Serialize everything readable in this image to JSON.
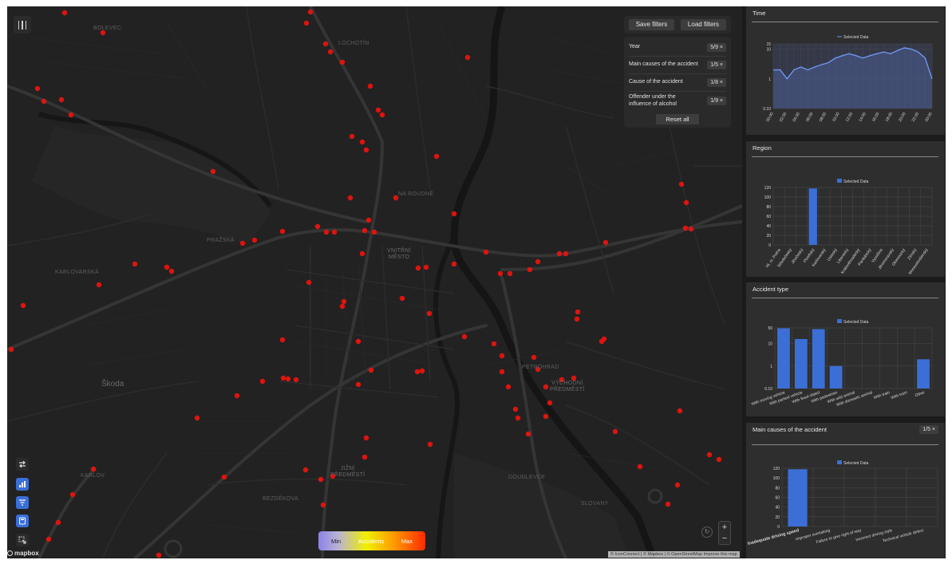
{
  "map": {
    "labels": [
      {
        "text": "Škoda",
        "style": "big",
        "x": 118,
        "y": 468
      },
      {
        "text": "VNITŘNÍ\nMĚSTO",
        "style": "district",
        "x": 476,
        "y": 303
      },
      {
        "text": "VÝCHODNÍ\nPŘEDMĚSTÍ",
        "style": "district",
        "x": 680,
        "y": 469
      },
      {
        "text": "JIŽNÍ\nPŘEDMĚSTÍ",
        "style": "district",
        "x": 405,
        "y": 576
      },
      {
        "text": "PETROHRAD",
        "style": "small",
        "x": 645,
        "y": 449
      },
      {
        "text": "KARLOV",
        "style": "small",
        "x": 92,
        "y": 585
      },
      {
        "text": "BEZDĚKOVA",
        "style": "small",
        "x": 320,
        "y": 614
      },
      {
        "text": "DOUDLEVCE",
        "style": "small",
        "x": 628,
        "y": 587
      },
      {
        "text": "SLOVANY",
        "style": "small",
        "x": 719,
        "y": 620
      },
      {
        "text": "BOLEVEC",
        "style": "small",
        "x": 108,
        "y": 24
      },
      {
        "text": "NA ROUDNÉ",
        "style": "small",
        "x": 490,
        "y": 232
      },
      {
        "text": "KARLOVARSKÁ",
        "style": "small",
        "x": 60,
        "y": 330
      },
      {
        "text": "LOCHOTÍN",
        "style": "small",
        "x": 415,
        "y": 43
      },
      {
        "text": "PRAŽSKÁ",
        "style": "small",
        "x": 250,
        "y": 290
      }
    ],
    "hotspot_color": "#e8140e",
    "toolbar_icons": [
      "route-icon",
      "bar-chart-icon",
      "filter-icon",
      "calculator-icon",
      "select-area-icon"
    ]
  },
  "filters": {
    "save_label": "Save filters",
    "load_label": "Load filters",
    "rows": [
      {
        "label": "Year",
        "badge": "5/9 ×"
      },
      {
        "label": "Main causes of the accident",
        "badge": "1/5 ×"
      },
      {
        "label": "Cause of the accident",
        "badge": "1/8 ×"
      },
      {
        "label": "Offender under the influence of alcohol",
        "badge": "1/9 ×"
      }
    ],
    "reset_label": "Reset all"
  },
  "legend": {
    "min": "Min",
    "mid": "Accidents",
    "max": "Max"
  },
  "zoom": {
    "plus": "+",
    "minus": "−"
  },
  "mapbox": {
    "logo": "mapbox",
    "attribution": "© IconConnect | © Mapbox | © OpenStreetMap Improve this map"
  },
  "panels": {
    "time": {
      "title": "Time"
    },
    "region": {
      "title": "Region"
    },
    "accident_type": {
      "title": "Accident type"
    },
    "main_causes": {
      "title": "Main causes of the accident",
      "badge": "1/5 ×"
    }
  },
  "chart_data": [
    {
      "type": "line",
      "panel": "Time",
      "legend": "Selected Data",
      "y_scale": "log",
      "ylim": [
        0.1,
        15
      ],
      "y_ticks": [
        "15",
        "10",
        "1",
        "0.10"
      ],
      "x": [
        "00:00",
        "01:00",
        "02:00",
        "03:00",
        "04:00",
        "05:00",
        "06:00",
        "07:00",
        "08:00",
        "09:00",
        "10:00",
        "11:00",
        "12:00",
        "13:00",
        "14:00",
        "15:00",
        "16:00",
        "17:00",
        "18:00",
        "19:00",
        "20:00",
        "21:00",
        "22:00",
        "23:00"
      ],
      "x_tick_labels": [
        "00:00",
        "02:00",
        "04:00",
        "06:00",
        "08:00",
        "10:00",
        "12:00",
        "14:00",
        "16:00",
        "18:00",
        "20:00",
        "22:00",
        "00:00"
      ],
      "values": [
        2,
        2,
        1,
        2,
        2.5,
        2,
        2.5,
        3,
        3.5,
        5,
        6,
        7,
        6,
        5,
        6,
        7,
        8,
        7,
        9,
        11,
        10,
        8,
        5,
        1
      ]
    },
    {
      "type": "bar",
      "panel": "Region",
      "legend": "Selected Data",
      "ylim": [
        0,
        120
      ],
      "y_ticks": [
        0,
        20,
        40,
        60,
        80,
        100,
        120
      ],
      "categories": [
        "Hl. m. Praha",
        "Středočeský",
        "Jihočeský",
        "Plzeňský",
        "Karlovarský",
        "Ústecký",
        "Liberecký",
        "Královéhradecký",
        "Pardubický",
        "Vysočina",
        "Jihomoravský",
        "Olomoucký",
        "Zlínský",
        "Moravskoslezský"
      ],
      "values": [
        0,
        0,
        0,
        118,
        0,
        0,
        0,
        0,
        0,
        0,
        0,
        0,
        0,
        0
      ]
    },
    {
      "type": "bar",
      "panel": "Accident type",
      "legend": "Selected Data",
      "y_scale": "log",
      "ylim": [
        0.1,
        50
      ],
      "y_ticks": [
        "50",
        "10",
        "1",
        "0.10"
      ],
      "categories": [
        "With moving vehicle",
        "With parked vehicle",
        "With fixed object",
        "With pedestrian",
        "With wild animal",
        "With domestic animal",
        "With train",
        "With tram",
        "Other"
      ],
      "values": [
        48,
        16,
        44,
        1,
        0,
        0,
        0,
        0,
        2
      ]
    },
    {
      "type": "bar",
      "panel": "Main causes of the accident",
      "legend": "Selected Data",
      "ylim": [
        0,
        120
      ],
      "y_ticks": [
        0,
        20,
        40,
        60,
        80,
        100,
        120
      ],
      "categories": [
        "Inadequate driving speed",
        "Improper overtaking",
        "Failure to give right of way",
        "Incorrect driving style",
        "Technical vehicle defect"
      ],
      "values": [
        118,
        0,
        0,
        0,
        0
      ]
    }
  ]
}
